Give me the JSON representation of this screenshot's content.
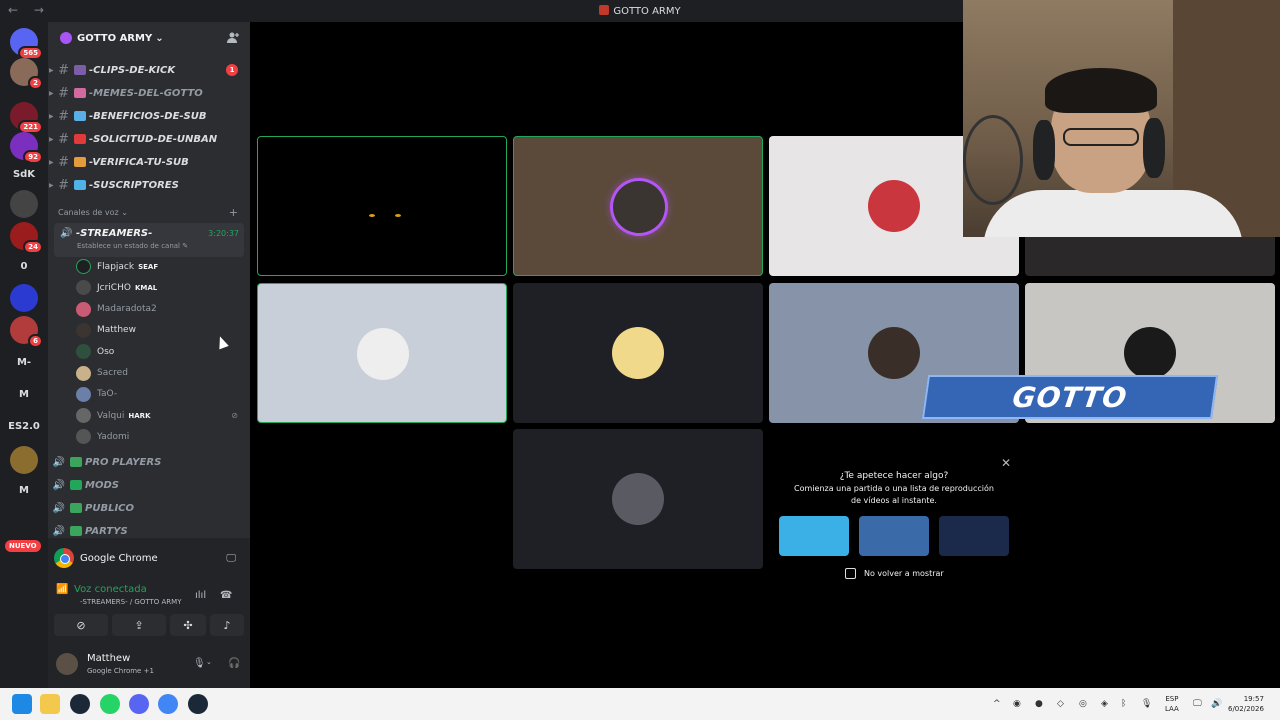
{
  "window": {
    "title": "GOTTO ARMY",
    "nav": "← →"
  },
  "guilds": [
    {
      "label": "",
      "badge": "565",
      "color": "#5865f2"
    },
    {
      "label": "",
      "badge": "2",
      "color": "#8a6b5a"
    },
    {
      "label": "",
      "badge": "221",
      "color": "#7a1b2b"
    },
    {
      "label": "",
      "badge": "92",
      "color": "#7b2fbf"
    },
    {
      "label": "SdK",
      "badge": "",
      "color": "#1e1f22"
    },
    {
      "label": "",
      "badge": "",
      "color": "#444"
    },
    {
      "label": "",
      "badge": "24",
      "color": "#9b1c1c"
    },
    {
      "label": "0",
      "badge": "",
      "color": "#1e1f22"
    },
    {
      "label": "",
      "badge": "",
      "color": "#2b3bd1"
    },
    {
      "label": "",
      "badge": "6",
      "color": "#b23b3b"
    },
    {
      "label": "M-",
      "badge": "",
      "color": "#1e1f22"
    },
    {
      "label": "M",
      "badge": "",
      "color": "#1e1f22"
    },
    {
      "label": "ES2.0",
      "badge": "",
      "color": "#1e1f22"
    },
    {
      "label": "",
      "badge": "",
      "color": "#8a6d2f"
    },
    {
      "label": "M",
      "badge": "",
      "color": "#1e1f22"
    }
  ],
  "new_badge": "NUEVO",
  "server": {
    "name": "GOTTO ARMY",
    "chevron": "⌄"
  },
  "channels": [
    {
      "name": "-CLIPS-DE-KICK",
      "emoji_color": "#7b5ea7",
      "unread": "1"
    },
    {
      "name": "-MEMES-DEL-GOTTO",
      "emoji_color": "#d26aa0",
      "unread": ""
    },
    {
      "name": "-BENEFICIOS-DE-SUB",
      "emoji_color": "#5ab0e6",
      "unread": ""
    },
    {
      "name": "-SOLICITUD-DE-UNBAN",
      "emoji_color": "#e03a3a",
      "unread": ""
    },
    {
      "name": "-VERIFICA-TU-SUB",
      "emoji_color": "#e39b3b",
      "unread": ""
    },
    {
      "name": "-SUSCRIPTORES",
      "emoji_color": "#4fb3e8",
      "unread": ""
    }
  ],
  "voice_category": {
    "label": "Canales de voz ⌄",
    "add": "+"
  },
  "voice_channel": {
    "name": "-STREAMERS-",
    "timer": "3:20:37",
    "status": "Establece un estado de canal ✎"
  },
  "members": [
    {
      "name": "Flapjack",
      "tag": "SEAF",
      "avatar": "#1e1f22",
      "dim": false,
      "muted": false
    },
    {
      "name": "JcriCHO",
      "tag": "KMAL",
      "avatar": "#4a4a4a",
      "dim": false,
      "muted": false
    },
    {
      "name": "Madaradota2",
      "tag": "",
      "avatar": "#c95c74",
      "dim": true,
      "muted": false
    },
    {
      "name": "Matthew",
      "tag": "",
      "avatar": "#3a3530",
      "dim": false,
      "muted": false
    },
    {
      "name": "Oso",
      "tag": "",
      "avatar": "#2f4f3f",
      "dim": false,
      "muted": false
    },
    {
      "name": "Sacred",
      "tag": "",
      "avatar": "#c9b18a",
      "dim": true,
      "muted": false
    },
    {
      "name": "TaO-",
      "tag": "",
      "avatar": "#6b7fa8",
      "dim": true,
      "muted": false
    },
    {
      "name": "Valqui",
      "tag": "HARK",
      "avatar": "#666",
      "dim": true,
      "muted": true
    },
    {
      "name": "Yadomi",
      "tag": "",
      "avatar": "#555",
      "dim": true,
      "muted": false
    }
  ],
  "other_voice": [
    {
      "name": "PRO PLAYERS",
      "emoji_color": "#3ba55c"
    },
    {
      "name": "MODS",
      "emoji_color": "#23a55a"
    },
    {
      "name": "PUBLICO",
      "emoji_color": "#3ba55c"
    },
    {
      "name": "PARTYS",
      "emoji_color": "#3ba55c"
    }
  ],
  "stream": {
    "app": "Google Chrome"
  },
  "voice_status": {
    "label": "Voz conectada",
    "location": "-STREAMERS- / GOTTO ARMY"
  },
  "user": {
    "name": "Matthew",
    "activity": "Google Chrome +1"
  },
  "tiles": [
    {
      "bg": "#000000",
      "avatar": "",
      "speaking": true,
      "eyes": true
    },
    {
      "bg": "#5b4a3a",
      "avatar": "#3a3530",
      "speaking": true,
      "eyes": false
    },
    {
      "bg": "#e8e5e6",
      "avatar": "#c9363e",
      "speaking": false,
      "eyes": false
    },
    {
      "bg": "#c9cfd8",
      "avatar": "#eeeeee",
      "speaking": true,
      "eyes": false
    },
    {
      "bg": "#1e2026",
      "avatar": "#f0d98a",
      "speaking": false,
      "eyes": false
    },
    {
      "bg": "#8793a8",
      "avatar": "#3a2e28",
      "speaking": false,
      "eyes": false
    },
    {
      "bg": "#c8c6c2",
      "avatar": "#1a1a1a",
      "speaking": false,
      "eyes": false
    },
    {
      "bg": "#1e2026",
      "avatar": "#5a5a62",
      "speaking": false,
      "eyes": false
    },
    {
      "bg": "#2a2828",
      "avatar": "",
      "speaking": false,
      "eyes": false
    }
  ],
  "overlay": {
    "text": "GOTTO"
  },
  "promo": {
    "question": "¿Te apetece hacer algo?",
    "description": "Comienza una partida o una lista de reproducción de vídeos al instante.",
    "games": [
      {
        "color": "#3bb0e6"
      },
      {
        "color": "#3a6aa8"
      },
      {
        "color": "#1b2a4a"
      }
    ],
    "checkbox_label": "No volver a mostrar",
    "close": "✕"
  },
  "taskbar": {
    "lang": "ESP",
    "region": "LAA",
    "time": "19:57",
    "date": "6/02/2026",
    "apps": [
      "start",
      "files",
      "steam",
      "whatsapp",
      "discord",
      "chrome",
      "steam2"
    ]
  }
}
